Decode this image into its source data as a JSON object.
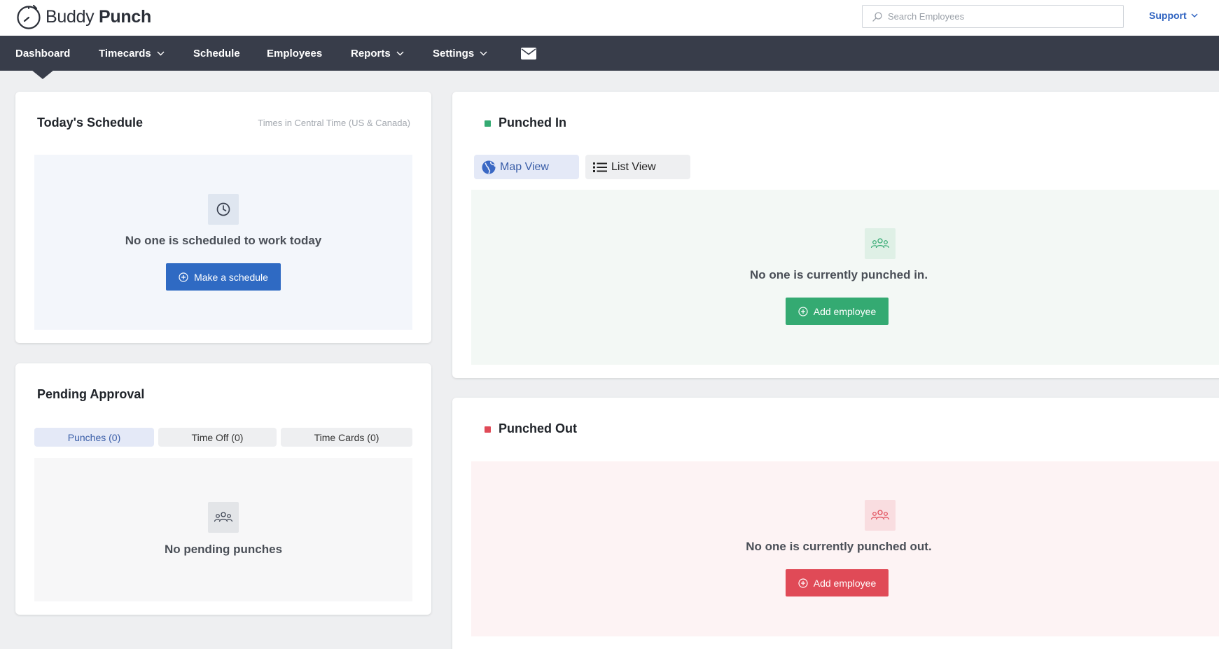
{
  "header": {
    "brand_light": "Buddy",
    "brand_bold": "Punch",
    "search_placeholder": "Search Employees",
    "support_label": "Support"
  },
  "nav": {
    "items": [
      {
        "label": "Dashboard",
        "active": true
      },
      {
        "label": "Timecards",
        "dropdown": true
      },
      {
        "label": "Schedule"
      },
      {
        "label": "Employees"
      },
      {
        "label": "Reports",
        "dropdown": true
      },
      {
        "label": "Settings",
        "dropdown": true
      }
    ],
    "mail_icon": "envelope-icon"
  },
  "schedule": {
    "title": "Today's Schedule",
    "timezone_note": "Times in Central Time (US & Canada)",
    "empty_text": "No one is scheduled to work today",
    "button_label": "Make a schedule",
    "icon": "clock-icon"
  },
  "pending": {
    "title": "Pending Approval",
    "tabs": [
      {
        "label": "Punches (0)",
        "active": true
      },
      {
        "label": "Time Off (0)"
      },
      {
        "label": "Time Cards (0)"
      }
    ],
    "empty_text": "No pending punches",
    "icon": "users-icon"
  },
  "punched_in": {
    "title": "Punched In",
    "views": [
      {
        "label": "Map View",
        "active": true,
        "icon": "globe-icon"
      },
      {
        "label": "List View",
        "icon": "list-icon"
      }
    ],
    "empty_text": "No one is currently punched in.",
    "button_label": "Add employee",
    "icon": "users-icon"
  },
  "punched_out": {
    "title": "Punched Out",
    "empty_text": "No one is currently punched out.",
    "button_label": "Add employee",
    "icon": "users-icon"
  },
  "colors": {
    "nav_bg": "#383d4a",
    "primary_blue": "#2f6ac3",
    "green": "#34aa72",
    "red": "#e04a57",
    "link_blue": "#2e62c0"
  }
}
